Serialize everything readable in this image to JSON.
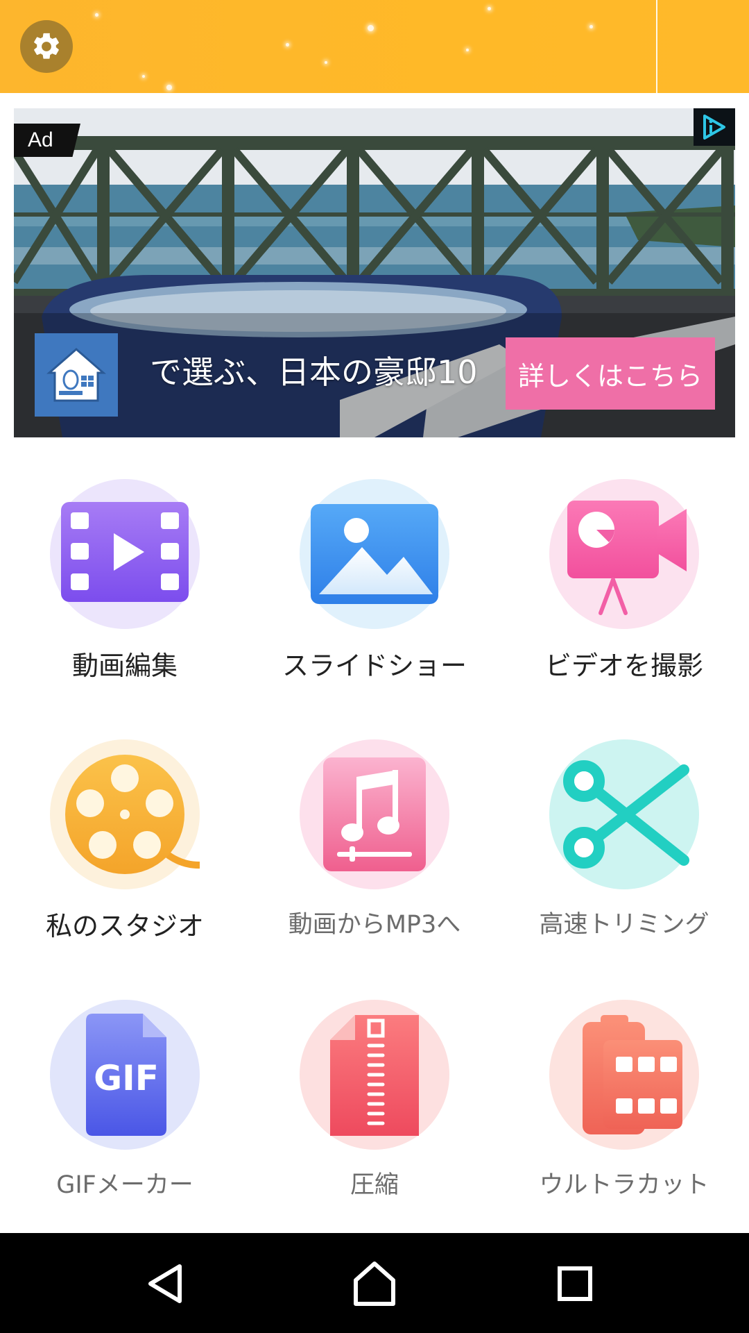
{
  "header": {
    "settings_icon": "gear-icon",
    "background_color": "#FFB92A"
  },
  "ad": {
    "badge": "Ad",
    "adchoices_icon": "adchoices-icon",
    "logo_icon": "house-icon",
    "headline": "で選ぶ、日本の豪邸10",
    "cta": "詳しくはこちら",
    "cta_color": "#EF6FA7"
  },
  "tiles": [
    {
      "label": "動画編集",
      "icon": "film-play-icon",
      "color": "#8F5CF0"
    },
    {
      "label": "スライドショー",
      "icon": "picture-icon",
      "color": "#3D8EF0"
    },
    {
      "label": "ビデオを撮影",
      "icon": "video-camera-icon",
      "color": "#F25FA6"
    },
    {
      "label": "私のスタジオ",
      "icon": "film-reel-icon",
      "color": "#F6AE2D"
    },
    {
      "label": "動画からMP3へ",
      "icon": "music-note-icon",
      "color": "#F06A96"
    },
    {
      "label": "高速トリミング",
      "icon": "scissors-icon",
      "color": "#22CFC2"
    },
    {
      "label": "GIFメーカー",
      "icon": "gif-file-icon",
      "color": "#5865F0"
    },
    {
      "label": "圧縮",
      "icon": "zip-file-icon",
      "color": "#F2566A"
    },
    {
      "label": "ウルトラカット",
      "icon": "ultra-cut-icon",
      "color": "#F2705E"
    }
  ],
  "navbar": {
    "back_icon": "back-icon",
    "home_icon": "home-icon",
    "recents_icon": "recents-icon"
  }
}
